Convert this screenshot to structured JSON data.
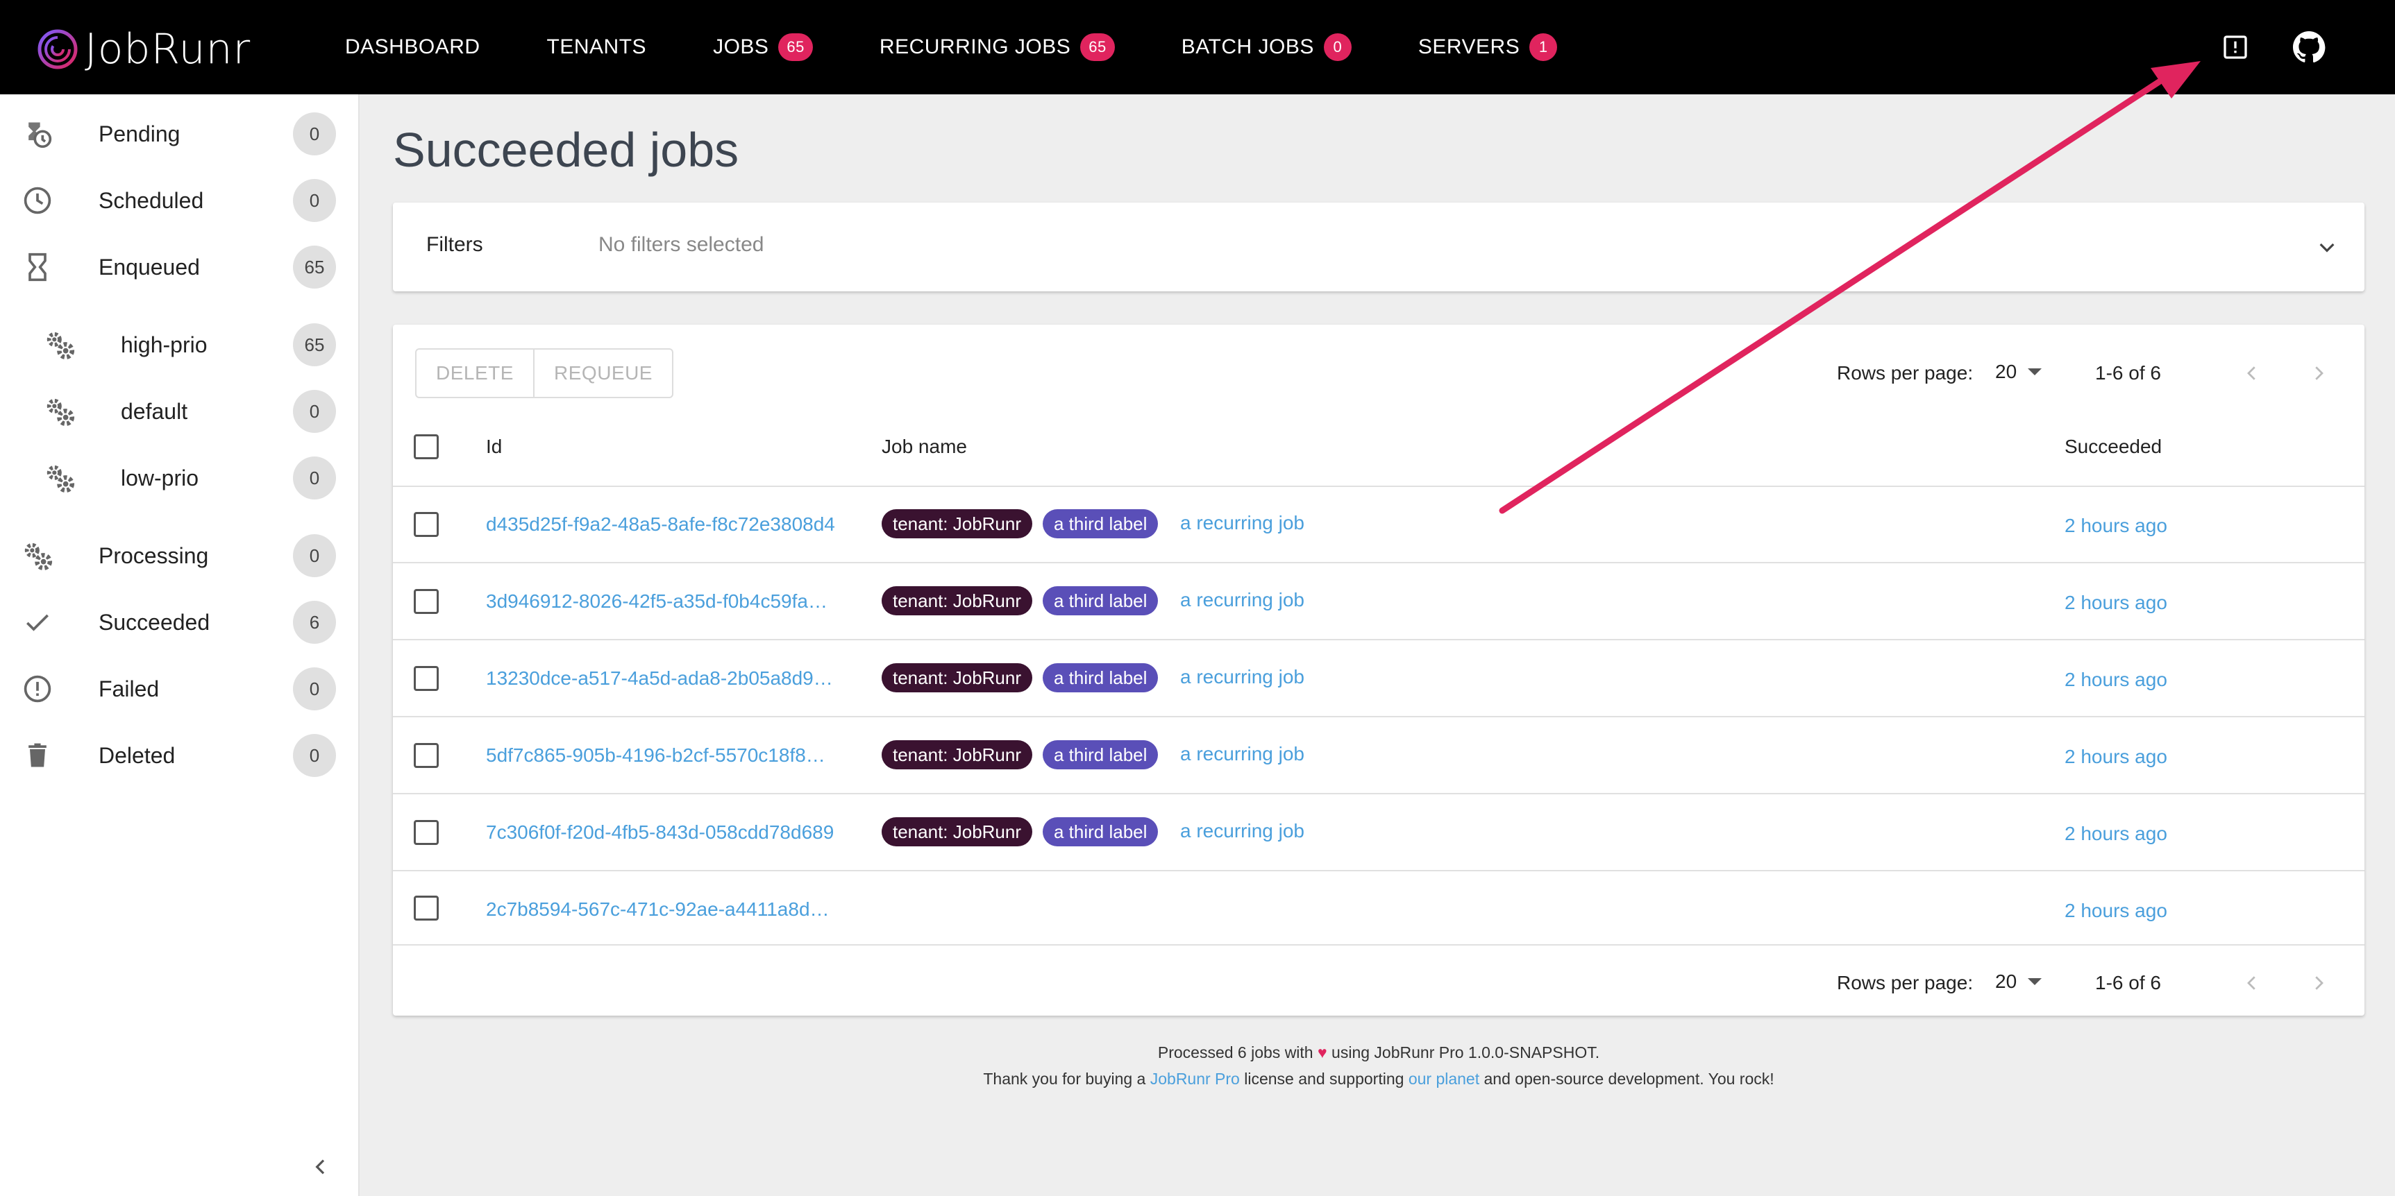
{
  "app": {
    "logo_text": "JobRunr"
  },
  "nav": [
    {
      "label": "DASHBOARD",
      "badge": null
    },
    {
      "label": "TENANTS",
      "badge": null
    },
    {
      "label": "JOBS",
      "badge": "65"
    },
    {
      "label": "RECURRING JOBS",
      "badge": "65"
    },
    {
      "label": "BATCH JOBS",
      "badge": "0"
    },
    {
      "label": "SERVERS",
      "badge": "1"
    }
  ],
  "sidebar": {
    "items": [
      {
        "label": "Pending",
        "count": "0",
        "icon": "pending-icon"
      },
      {
        "label": "Scheduled",
        "count": "0",
        "icon": "clock-icon"
      },
      {
        "label": "Enqueued",
        "count": "65",
        "icon": "hourglass-icon"
      },
      {
        "label": "high-prio",
        "count": "65",
        "icon": "gears-icon"
      },
      {
        "label": "default",
        "count": "0",
        "icon": "gears-icon"
      },
      {
        "label": "low-prio",
        "count": "0",
        "icon": "gears-icon"
      },
      {
        "label": "Processing",
        "count": "0",
        "icon": "gears-icon"
      },
      {
        "label": "Succeeded",
        "count": "6",
        "icon": "check-icon"
      },
      {
        "label": "Failed",
        "count": "0",
        "icon": "alert-circle-icon"
      },
      {
        "label": "Deleted",
        "count": "0",
        "icon": "trash-icon"
      }
    ]
  },
  "main": {
    "title": "Succeeded jobs",
    "filters": {
      "label": "Filters",
      "value": "No filters selected"
    },
    "actions": {
      "delete": "DELETE",
      "requeue": "REQUEUE"
    },
    "pagination": {
      "rows_label": "Rows per page:",
      "rows_value": "20",
      "range": "1-6 of 6"
    },
    "columns": {
      "id": "Id",
      "job_name": "Job name",
      "succeeded": "Succeeded"
    },
    "rows": [
      {
        "id": "d435d25f-f9a2-48a5-8afe-f8c72e3808d4",
        "labels": [
          "tenant: JobRunr",
          "a third label"
        ],
        "job_name": "a recurring job",
        "succeeded": "2 hours ago"
      },
      {
        "id": "3d946912-8026-42f5-a35d-f0b4c59fa…",
        "labels": [
          "tenant: JobRunr",
          "a third label"
        ],
        "job_name": "a recurring job",
        "succeeded": "2 hours ago"
      },
      {
        "id": "13230dce-a517-4a5d-ada8-2b05a8d9…",
        "labels": [
          "tenant: JobRunr",
          "a third label"
        ],
        "job_name": "a recurring job",
        "succeeded": "2 hours ago"
      },
      {
        "id": "5df7c865-905b-4196-b2cf-5570c18f8…",
        "labels": [
          "tenant: JobRunr",
          "a third label"
        ],
        "job_name": "a recurring job",
        "succeeded": "2 hours ago"
      },
      {
        "id": "7c306f0f-f20d-4fb5-843d-058cdd78d689",
        "labels": [
          "tenant: JobRunr",
          "a third label"
        ],
        "job_name": "a recurring job",
        "succeeded": "2 hours ago"
      },
      {
        "id": "2c7b8594-567c-471c-92ae-a4411a8d…",
        "labels": [],
        "job_name": "",
        "succeeded": "2 hours ago"
      }
    ]
  },
  "footer": {
    "line1_a": "Processed 6 jobs with",
    "heart": "♥",
    "line1_b": "using JobRunr Pro 1.0.0-SNAPSHOT.",
    "line2_a": "Thank you for buying a",
    "link_pro": "JobRunr Pro",
    "line2_b": "license and supporting",
    "link_planet": "our planet",
    "line2_c": "and open-source development. You rock!"
  },
  "colors": {
    "accent_badge": "#e0245e",
    "link": "#4a9fdc",
    "tenant_chip": "#3a1230",
    "label_chip": "#5a4fb8",
    "annotation_arrow": "#e0245e"
  }
}
